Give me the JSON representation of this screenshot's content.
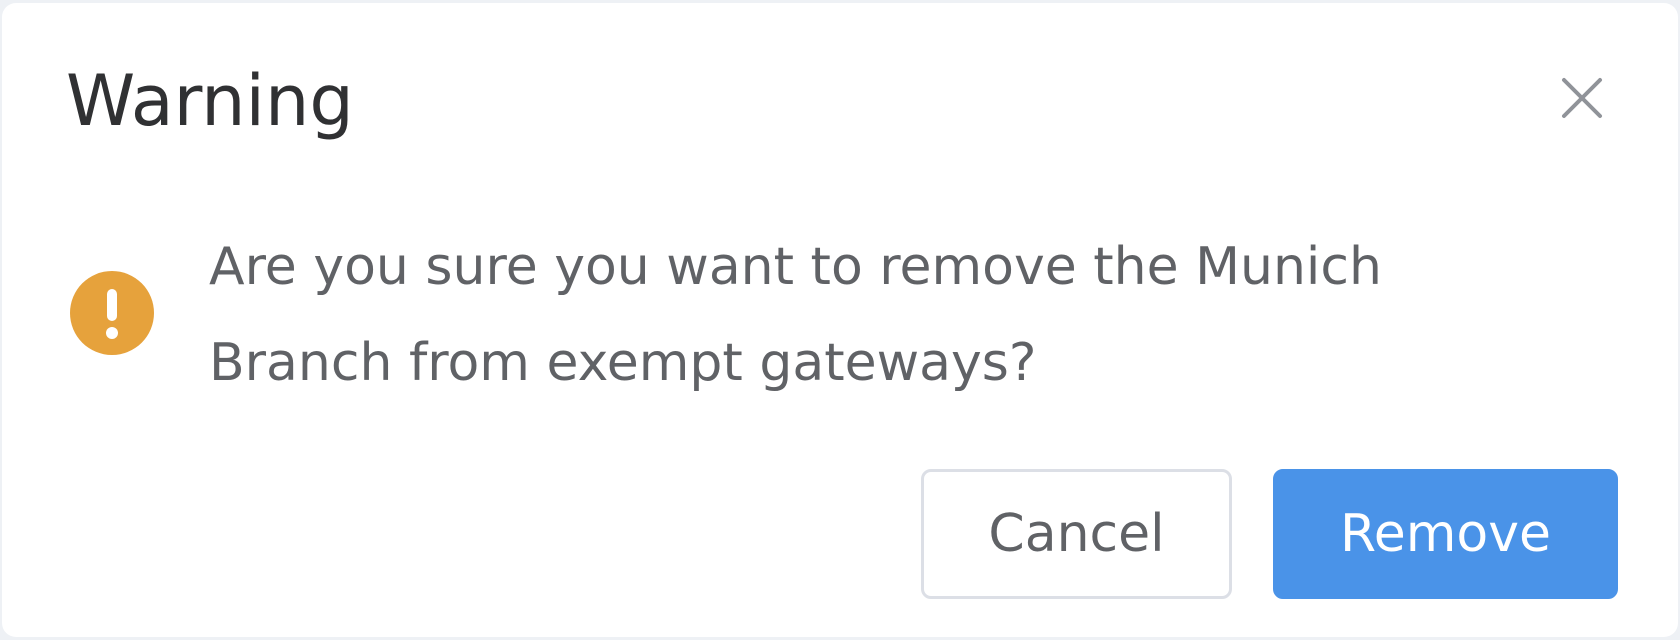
{
  "dialog": {
    "title": "Warning",
    "close_icon": "close-icon",
    "status_icon": "warning-icon",
    "message": "Are you sure you want to remove the Munich Branch from exempt gateways?",
    "cancel_label": "Cancel",
    "confirm_label": "Remove"
  },
  "colors": {
    "warning": "#e6a23c",
    "primary": "#4a93e8",
    "title_text": "#303133",
    "body_text": "#606266",
    "border": "#dcdfe6",
    "close_icon": "#909399"
  }
}
